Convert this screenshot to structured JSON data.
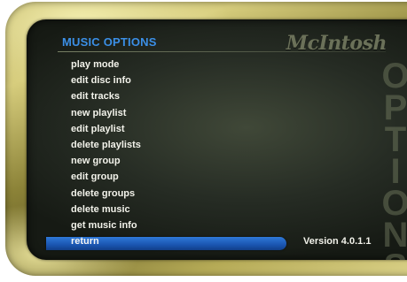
{
  "menu": {
    "title": "MUSIC OPTIONS",
    "items": [
      {
        "label": "play mode"
      },
      {
        "label": "edit disc info"
      },
      {
        "label": "edit tracks"
      },
      {
        "label": "new playlist"
      },
      {
        "label": "edit playlist"
      },
      {
        "label": "delete playlists"
      },
      {
        "label": "new group"
      },
      {
        "label": "edit group"
      },
      {
        "label": "delete groups"
      },
      {
        "label": "delete music"
      },
      {
        "label": "get music info"
      },
      {
        "label": "return",
        "selected": true
      }
    ]
  },
  "brand": {
    "logo": "McIntosh",
    "watermark": "OPTIONS"
  },
  "version": "Version 4.0.1.1",
  "colors": {
    "title": "#3b8fe6",
    "highlight": "#1f5fc0",
    "text": "#f2f2ea",
    "bezel": "#b9ad5b"
  }
}
